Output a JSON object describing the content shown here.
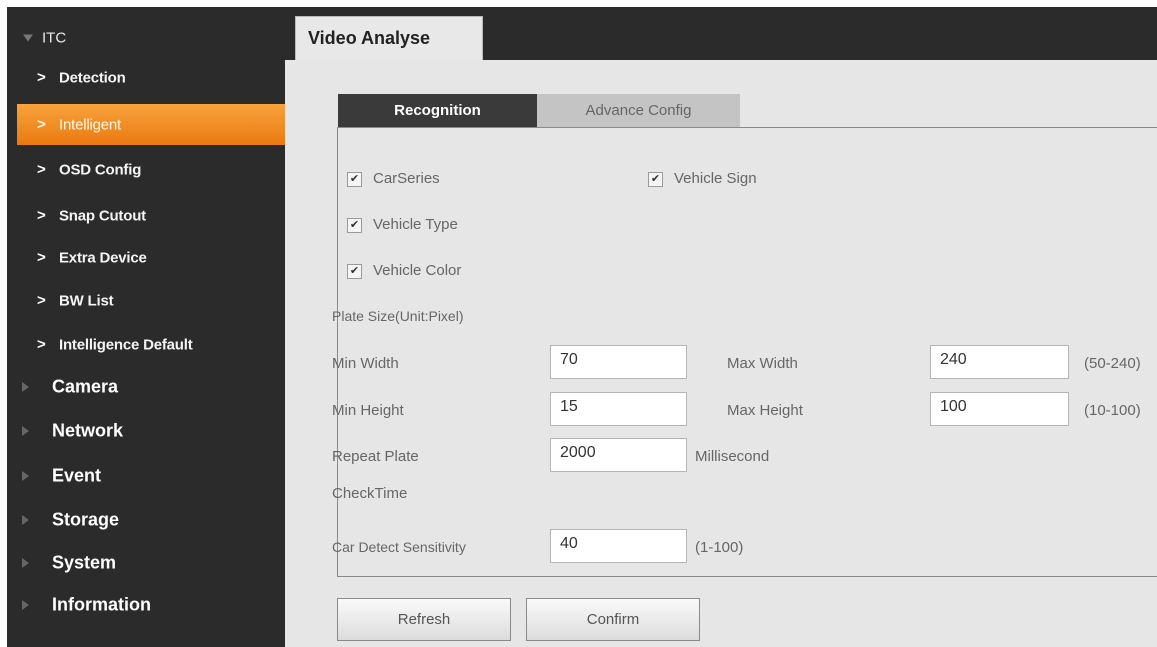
{
  "sidebar": {
    "itc_label": "ITC",
    "sub_items": [
      {
        "label": "Detection"
      },
      {
        "label": "Intelligent",
        "active": true
      },
      {
        "label": "OSD Config"
      },
      {
        "label": "Snap Cutout"
      },
      {
        "label": "Extra Device"
      },
      {
        "label": "BW List"
      },
      {
        "label": "Intelligence Default"
      }
    ],
    "top_items": [
      {
        "label": "Camera"
      },
      {
        "label": "Network"
      },
      {
        "label": "Event"
      },
      {
        "label": "Storage"
      },
      {
        "label": "System"
      },
      {
        "label": "Information"
      }
    ],
    "active_color": "#f08a1c"
  },
  "page": {
    "title": "Video Analyse"
  },
  "tabs": {
    "recognition": "Recognition",
    "advance_config": "Advance Config"
  },
  "recognition": {
    "checkboxes": {
      "car_series": {
        "label": "CarSeries",
        "checked": true
      },
      "vehicle_sign": {
        "label": "Vehicle Sign",
        "checked": true
      },
      "vehicle_type": {
        "label": "Vehicle Type",
        "checked": true
      },
      "vehicle_color": {
        "label": "Vehicle Color",
        "checked": true
      }
    },
    "plate_size_label": "Plate Size(Unit:Pixel)",
    "min_width": {
      "label": "Min Width",
      "value": "70"
    },
    "max_width": {
      "label": "Max Width",
      "value": "240",
      "range": "(50-240)"
    },
    "min_height": {
      "label": "Min Height",
      "value": "15"
    },
    "max_height": {
      "label": "Max Height",
      "value": "100",
      "range": "(10-100)"
    },
    "repeat_plate": {
      "label_line1": "Repeat Plate",
      "label_line2": "CheckTime",
      "value": "2000",
      "unit": "Millisecond"
    },
    "car_detect_sensitivity": {
      "label": "Car Detect Sensitivity",
      "value": "40",
      "range": "(1-100)"
    }
  },
  "buttons": {
    "refresh": "Refresh",
    "confirm": "Confirm"
  },
  "check_glyph": "✔"
}
